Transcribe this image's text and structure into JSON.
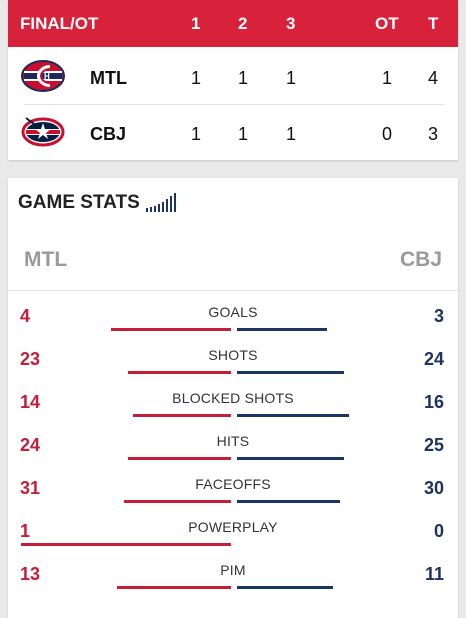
{
  "scoreboard": {
    "status": "FINAL/OT",
    "periods": [
      "1",
      "2",
      "3"
    ],
    "ot_label": "OT",
    "total_label": "T",
    "teams": [
      {
        "abbr": "MTL",
        "scores": [
          "1",
          "1",
          "1"
        ],
        "ot": "1",
        "total": "4",
        "logo": "habs-logo"
      },
      {
        "abbr": "CBJ",
        "scores": [
          "1",
          "1",
          "1"
        ],
        "ot": "0",
        "total": "3",
        "logo": "blue-jackets-logo"
      }
    ]
  },
  "game_stats": {
    "title": "GAME STATS",
    "left_team": "MTL",
    "right_team": "CBJ",
    "colors": {
      "left": "#c41e3a",
      "right": "#1b3461",
      "header": "#d8213a"
    },
    "stats": [
      {
        "label": "GOALS",
        "left": "4",
        "right": "3",
        "left_num": 4,
        "right_num": 3
      },
      {
        "label": "SHOTS",
        "left": "23",
        "right": "24",
        "left_num": 23,
        "right_num": 24
      },
      {
        "label": "BLOCKED SHOTS",
        "left": "14",
        "right": "16",
        "left_num": 14,
        "right_num": 16
      },
      {
        "label": "HITS",
        "left": "24",
        "right": "25",
        "left_num": 24,
        "right_num": 25
      },
      {
        "label": "FACEOFFS",
        "left": "31",
        "right": "30",
        "left_num": 31,
        "right_num": 30
      },
      {
        "label": "POWERPLAY",
        "left": "1",
        "right": "0",
        "left_num": 1,
        "right_num": 0
      },
      {
        "label": "PIM",
        "left": "13",
        "right": "11",
        "left_num": 13,
        "right_num": 11
      }
    ]
  }
}
